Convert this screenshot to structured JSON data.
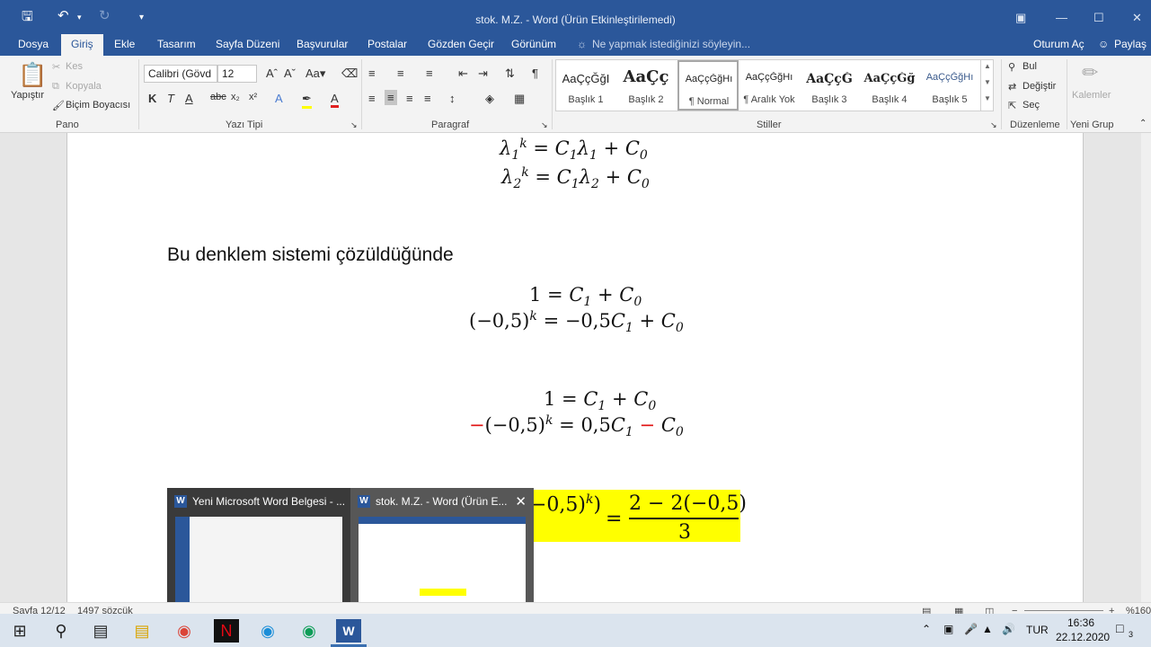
{
  "titlebar": {
    "title": "stok. M.Z. - Word (Ürün Etkinleştirilemedi)",
    "save_icon": "save-icon",
    "undo_icon": "undo-icon",
    "redo_icon": "redo-icon"
  },
  "menu": {
    "tabs": [
      "Dosya",
      "Giriş",
      "Ekle",
      "Tasarım",
      "Sayfa Düzeni",
      "Başvurular",
      "Postalar",
      "Gözden Geçir",
      "Görünüm"
    ],
    "tell_me": "Ne yapmak istediğinizi söyleyin...",
    "signin": "Oturum Aç",
    "share": "Paylaş"
  },
  "ribbon": {
    "clipboard": {
      "paste": "Yapıştır",
      "cut": "Kes",
      "copy": "Kopyala",
      "format_painter": "Biçim Boyacısı",
      "group": "Pano"
    },
    "font": {
      "name": "Calibri (Gövd",
      "size": "12",
      "group": "Yazı Tipi"
    },
    "paragraph": {
      "group": "Paragraf"
    },
    "styles": {
      "group": "Stiller",
      "items": [
        {
          "preview": "AaÇçĞğI",
          "name": "Başlık 1"
        },
        {
          "preview": "AaÇç",
          "name": "Başlık 2"
        },
        {
          "preview": "AaÇçĞğHı",
          "name": "¶ Normal"
        },
        {
          "preview": "AaÇçĞğHı",
          "name": "¶ Aralık Yok"
        },
        {
          "preview": "AaÇçĞ",
          "name": "Başlık 3"
        },
        {
          "preview": "AaÇçĞğ",
          "name": "Başlık 4"
        },
        {
          "preview": "AaÇçĞğHı",
          "name": "Başlık 5"
        }
      ]
    },
    "editing": {
      "find": "Bul",
      "replace": "Değiştir",
      "select": "Seç",
      "group": "Düzenleme"
    },
    "newgroup": {
      "pens": "Kalemler",
      "group": "Yeni Grup"
    }
  },
  "document": {
    "body_text": "Bu denklem sistemi çözüldüğünde"
  },
  "thumbnails": [
    {
      "title": "Yeni Microsoft Word Belgesi - ..."
    },
    {
      "title": "stok. M.Z. - Word (Ürün E..."
    }
  ],
  "statusbar": {
    "page": "Sayfa 12/12",
    "words": "1497 sözcük",
    "zoom": "%160"
  },
  "taskbar": {
    "lang": "TUR",
    "time": "16:36",
    "date": "22.12.2020",
    "notifications": "3"
  }
}
